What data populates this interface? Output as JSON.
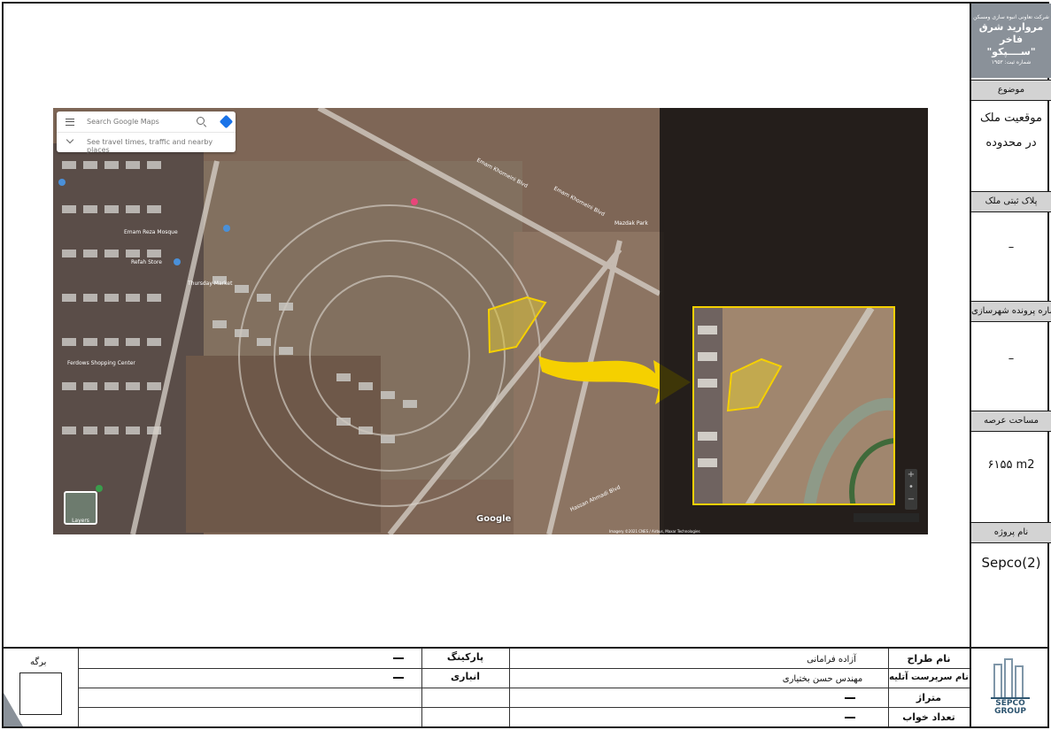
{
  "company": {
    "line1": "شرکت تعاونی انبوه سازی ومسکن",
    "line2": "مروارید شرق فاخر",
    "line3": "\"ســــپکو\"",
    "line4": "شماره ثبت: ۱۹۵۳"
  },
  "sidebar": {
    "subject_label": "موضوع",
    "subject_line1": "موقعیت ملک",
    "subject_line2": "در محدوده",
    "plaque_label": "پلاک ثبتی ملک",
    "plaque_value": "–",
    "permit_label": "شماره پرونده شهرسازی",
    "permit_value": "–",
    "area_label": "مساحت عرصه",
    "area_value": "۶۱۵۵ m2",
    "project_label": "نام پروژه",
    "project_value": "Sepco(2)"
  },
  "map": {
    "search_placeholder": "Search Google Maps",
    "travel_hint": "See travel times, traffic and nearby places",
    "layers_label": "Layers",
    "google": "Google",
    "imagery": "Imagery ©2021 CNES / Airbus, Maxar Technologies",
    "street_labels": [
      "Emam Khomeini Blvd",
      "Emam Khomeini Blvd",
      "Emam Reza Mosque",
      "Refah Store",
      "Thursday Market",
      "Ferdows Shopping Center",
      "Mazdak Park",
      "Hassan Ahmadi Blvd"
    ]
  },
  "bottom": {
    "page_label": "برگه",
    "parking_label": "پارکینگ",
    "parking_value": "–",
    "storage_label": "انباری",
    "storage_value": "–",
    "designer_label": "نام طراح",
    "designer_value": "آزاده فرامانی",
    "supervisor_label": "نام سرپرست آتلیه",
    "supervisor_value": "مهندس حسن بختیاری",
    "meterage_label": "متراژ",
    "meterage_value": "–",
    "bedrooms_label": "تعداد خواب",
    "bedrooms_value": "–",
    "logo_line1": "SEPCO",
    "logo_line2": "GROUP"
  },
  "colors": {
    "accent_gray": "#8a9199",
    "label_gray": "#d3d3d3",
    "highlight_yellow": "#f5d000",
    "logo_blue": "#2e5570"
  }
}
